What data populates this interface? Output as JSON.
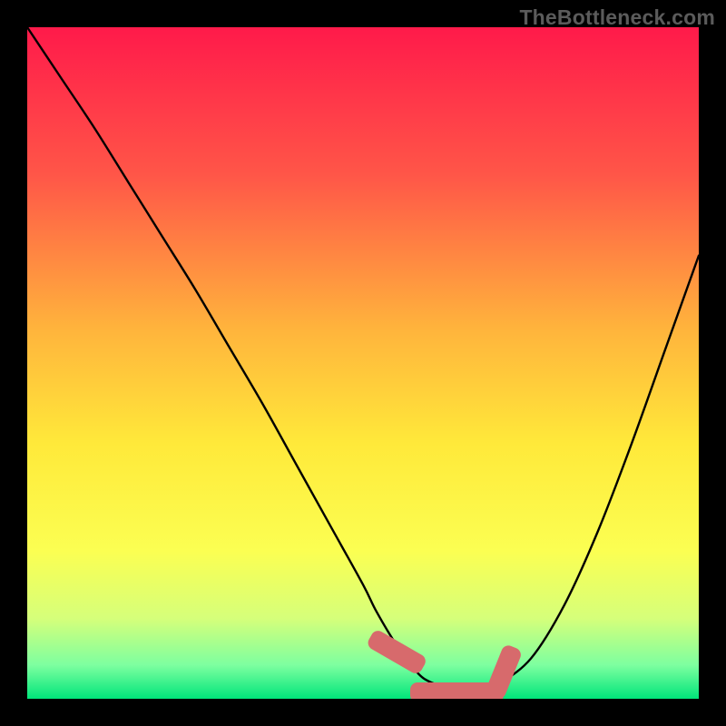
{
  "watermark": "TheBottleneck.com",
  "chart_data": {
    "type": "line",
    "title": "",
    "xlabel": "",
    "ylabel": "",
    "xlim": [
      0,
      100
    ],
    "ylim": [
      0,
      100
    ],
    "grid": false,
    "legend": false,
    "gradient_stops": [
      {
        "offset": 0,
        "color": "#ff1a4a"
      },
      {
        "offset": 22,
        "color": "#ff5648"
      },
      {
        "offset": 45,
        "color": "#ffb43c"
      },
      {
        "offset": 62,
        "color": "#ffe93a"
      },
      {
        "offset": 78,
        "color": "#fbff52"
      },
      {
        "offset": 88,
        "color": "#d6ff7a"
      },
      {
        "offset": 95,
        "color": "#7dffa0"
      },
      {
        "offset": 100,
        "color": "#00e57a"
      }
    ],
    "series": [
      {
        "name": "bottleneck-curve",
        "color": "#000000",
        "x": [
          0,
          5,
          10,
          15,
          20,
          25,
          30,
          35,
          40,
          45,
          50,
          52,
          55,
          58,
          60,
          63,
          65,
          68,
          70,
          75,
          80,
          85,
          90,
          95,
          100
        ],
        "y": [
          100,
          92.5,
          85,
          77,
          69,
          61,
          52.5,
          44,
          35,
          26,
          17,
          13,
          8,
          4,
          2.5,
          1.5,
          1,
          1,
          2,
          6,
          14,
          25,
          38,
          52,
          66
        ]
      }
    ],
    "markers": [
      {
        "name": "left-marker",
        "cx": 55,
        "cy": 7,
        "w": 3,
        "h": 9,
        "angle": -60
      },
      {
        "name": "floor-marker",
        "cx": 64,
        "cy": 1,
        "w": 14,
        "h": 3,
        "angle": 0
      },
      {
        "name": "right-marker",
        "cx": 71,
        "cy": 4,
        "w": 3,
        "h": 8,
        "angle": 22
      }
    ]
  }
}
